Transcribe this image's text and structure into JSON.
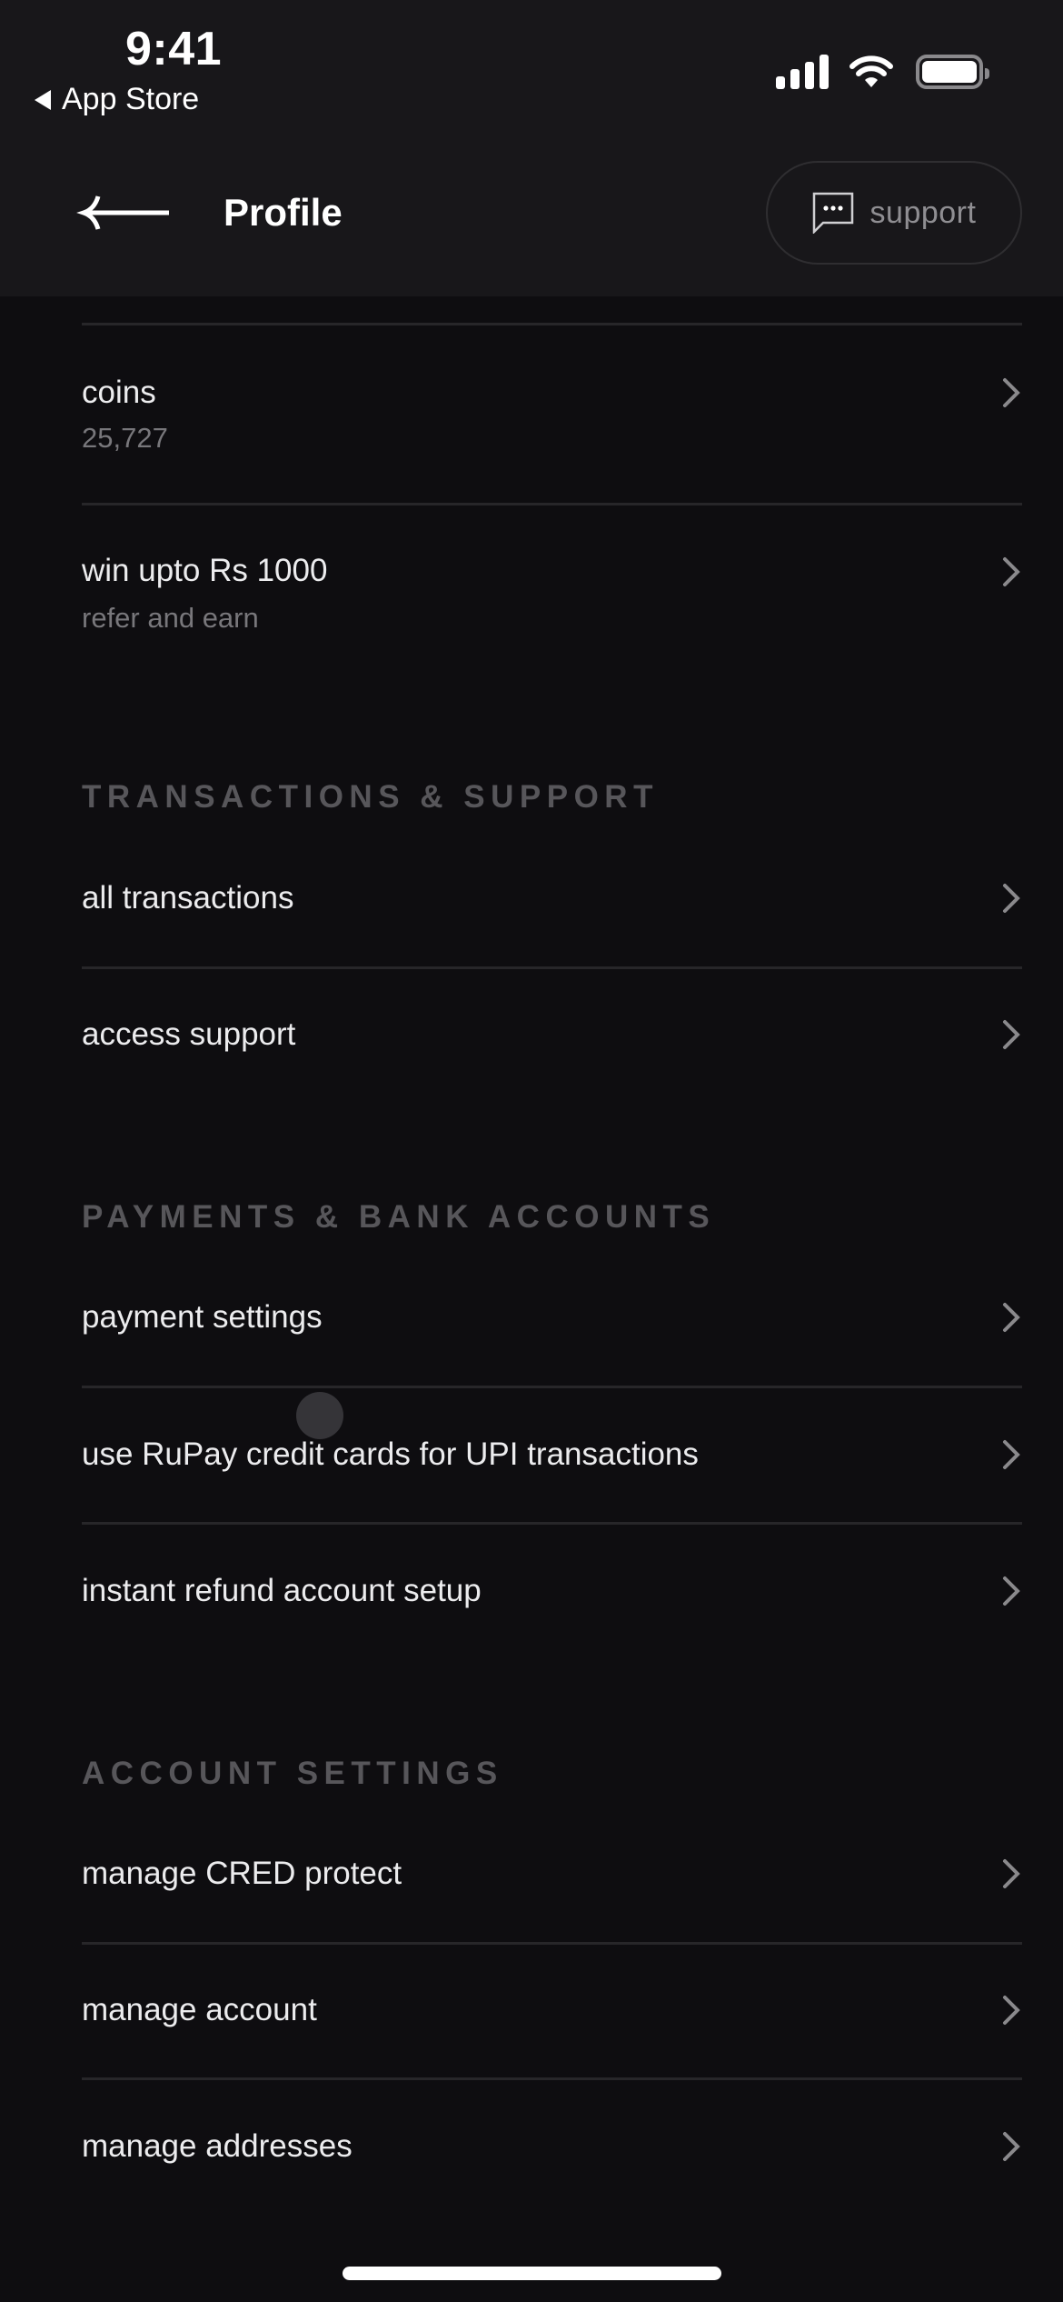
{
  "status_bar": {
    "time": "9:41",
    "back_app": "App Store",
    "icons": [
      "signal-icon",
      "wifi-icon",
      "battery-icon"
    ]
  },
  "header": {
    "back_icon": "arrow-left-icon",
    "title": "Profile",
    "support": {
      "icon": "chat-bubble-icon",
      "label": "support"
    }
  },
  "top_items": [
    {
      "title": "coins",
      "subtitle": "25,727"
    },
    {
      "title": "win upto Rs 1000",
      "subtitle": "refer and earn"
    }
  ],
  "sections": [
    {
      "heading": "TRANSACTIONS & SUPPORT",
      "items": [
        {
          "title": "all transactions"
        },
        {
          "title": "access support"
        }
      ]
    },
    {
      "heading": "PAYMENTS & BANK ACCOUNTS",
      "items": [
        {
          "title": "payment settings"
        },
        {
          "title": "use RuPay credit cards for UPI transactions"
        },
        {
          "title": "instant refund account setup"
        }
      ]
    },
    {
      "heading": "ACCOUNT SETTINGS",
      "items": [
        {
          "title": "manage CRED protect"
        },
        {
          "title": "manage account"
        },
        {
          "title": "manage addresses"
        }
      ]
    }
  ],
  "colors": {
    "header_bg": "#18171a",
    "page_bg": "#0e0d10",
    "divider": "#272629",
    "section_heading": "#57565a",
    "subtitle": "#78777b",
    "chevron": "#8a898c"
  }
}
